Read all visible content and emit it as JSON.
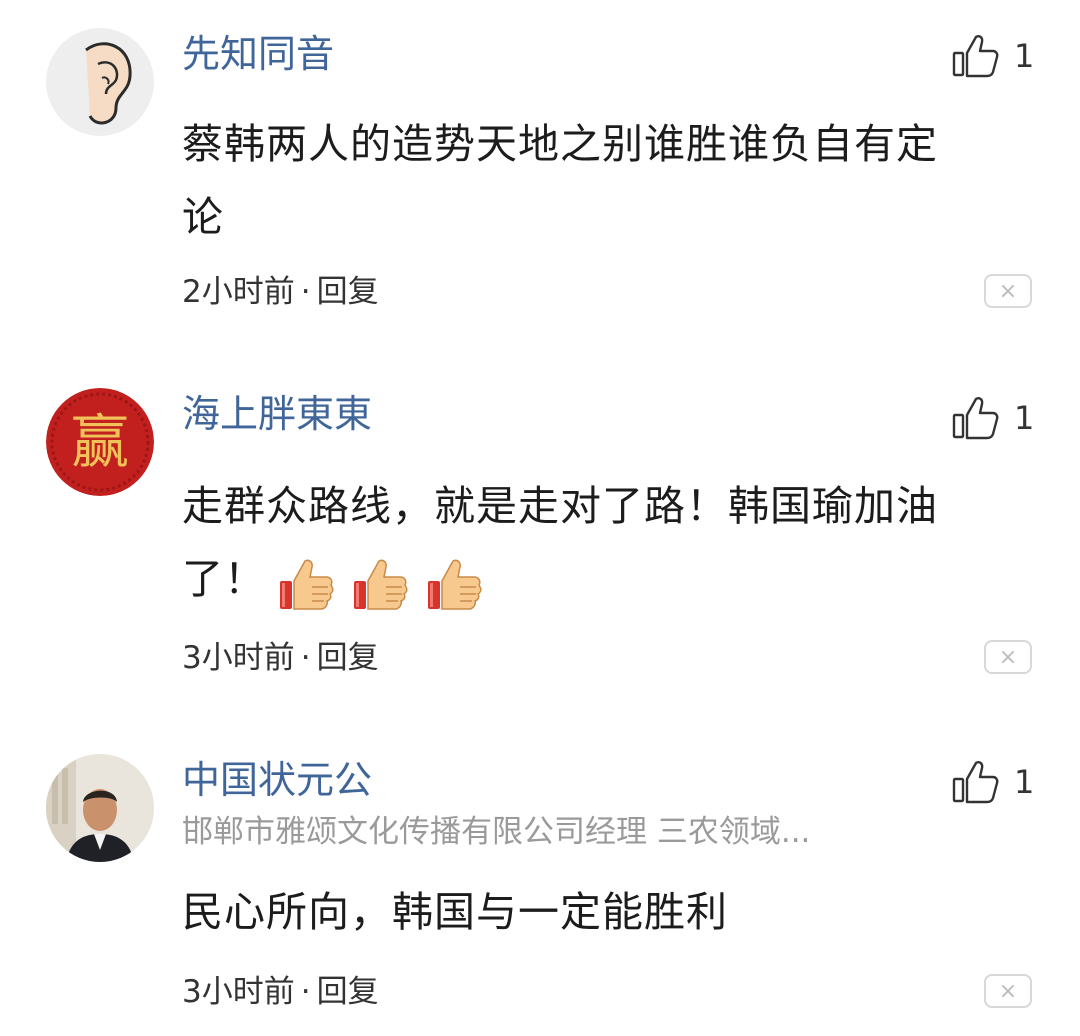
{
  "comments": [
    {
      "username": "先知同音",
      "subtitle": "",
      "like_count": "1",
      "content_line1": "蔡韩两人的造势天地之别谁胜谁负自有定",
      "content_line2": "论",
      "time": "2小时前",
      "separator": "·",
      "reply_label": "回复",
      "avatar_icon": "ear-icon"
    },
    {
      "username": "海上胖東東",
      "subtitle": "",
      "like_count": "1",
      "content_line1": "走群众路线，就是走对了路！韩国瑜加油",
      "content_line2": "了！",
      "emoji_count": 3,
      "time": "3小时前",
      "separator": "·",
      "reply_label": "回复",
      "avatar_icon": "seal-icon",
      "avatar_text": "赢"
    },
    {
      "username": "中国状元公",
      "subtitle": "邯郸市雅颂文化传播有限公司经理 三农领域...",
      "like_count": "1",
      "content_line1": "民心所向，韩国与一定能胜利",
      "time": "3小时前",
      "separator": "·",
      "reply_label": "回复",
      "avatar_icon": "photo-avatar"
    }
  ],
  "colors": {
    "username": "#406599",
    "subtitle": "#9a9a9a",
    "text": "#1c1c1c",
    "seal_red": "#c1201f",
    "seal_gold": "#f2c25a"
  },
  "icons": {
    "like": "thumbs-up-outline-icon",
    "close": "close-icon",
    "emoji": "thumbs-up-emoji"
  },
  "close_glyph": "×"
}
